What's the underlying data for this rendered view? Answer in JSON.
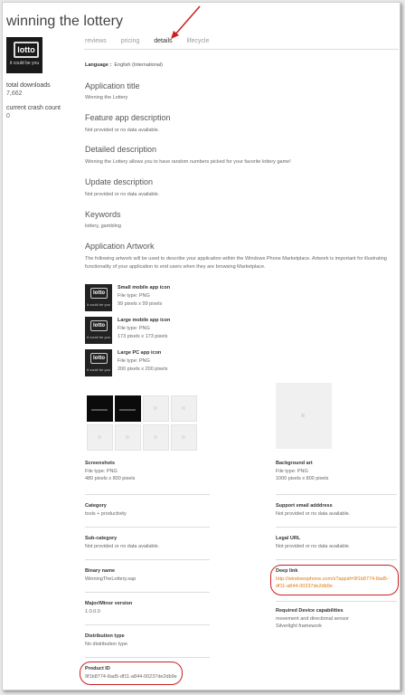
{
  "app": {
    "title": "winning the lottery"
  },
  "tabs": [
    {
      "label": "reviews"
    },
    {
      "label": "pricing"
    },
    {
      "label": "details"
    },
    {
      "label": "lifecycle"
    }
  ],
  "tile": {
    "logo": "lotto",
    "caption": "it could be you"
  },
  "stats": {
    "downloads_label": "total downloads",
    "downloads_value": "7,662",
    "crash_label": "current crash count",
    "crash_value": "0"
  },
  "language": {
    "label": "Language :",
    "value": "English (International)"
  },
  "sections": {
    "title": {
      "heading": "Application title",
      "text": "Winning the Lottery"
    },
    "feature": {
      "heading": "Feature app description",
      "text": "Not provided or no data available."
    },
    "detailed": {
      "heading": "Detailed description",
      "text": "Winning the Lottery allows you to have random numbers picked for your favorite lottery game!"
    },
    "update": {
      "heading": "Update description",
      "text": "Not provided or no data available."
    },
    "keywords": {
      "heading": "Keywords",
      "text": "lottery, gambling"
    },
    "artwork": {
      "heading": "Application Artwork",
      "text": "The following artwork will be used to describe your application within the Windows Phone Marketplace. Artwork is important for illustrating functionality of your application to end users when they are browsing Marketplace."
    }
  },
  "icons": [
    {
      "name": "Small mobile app icon",
      "filetype": "File type: PNG",
      "size": "99 pixels x 99 pixels"
    },
    {
      "name": "Large mobile app icon",
      "filetype": "File type: PNG",
      "size": "173 pixels x 173 pixels"
    },
    {
      "name": "Large PC app icon",
      "filetype": "File type: PNG",
      "size": "200 pixels x 200 pixels"
    }
  ],
  "screenshots": {
    "label": "Screenshots",
    "filetype": "File type: PNG",
    "size": "480 pixels x 800 pixels"
  },
  "background_art": {
    "label": "Background art",
    "filetype": "File type: PNG",
    "size": "1000 pixels x 800 pixels"
  },
  "category": {
    "label": "Category",
    "value": "tools + productivity"
  },
  "support_email": {
    "label": "Support email adddress",
    "value": "Not provided or no data available."
  },
  "sub_category": {
    "label": "Sub-category",
    "value": "Not provided or no data available."
  },
  "legal_url": {
    "label": "Legal URL",
    "value": "Not provided or no data available."
  },
  "binary": {
    "label": "Binary name",
    "value": "WinningTheLottery.xap"
  },
  "deep_link": {
    "label": "Deep link",
    "line1": "http://windowsphone.com/s?appid=9f1b8774-8ad5-",
    "line2": "df11-a844-00237de2db9e"
  },
  "version": {
    "label": "Major/Minor version",
    "value": "1.0.0.0"
  },
  "capabilities": {
    "label": "Required Device capabilities",
    "line1": "movement and directional sensor",
    "line2": "Silverlight framework"
  },
  "distribution": {
    "label": "Distribution type",
    "value": "No distribution type"
  },
  "product_id": {
    "label": "Product ID",
    "value": "9f1b8774-8ad5-df11-a844-00237de2db9e"
  },
  "colors": {
    "link": "#e07a10",
    "annotation": "#c92020"
  }
}
